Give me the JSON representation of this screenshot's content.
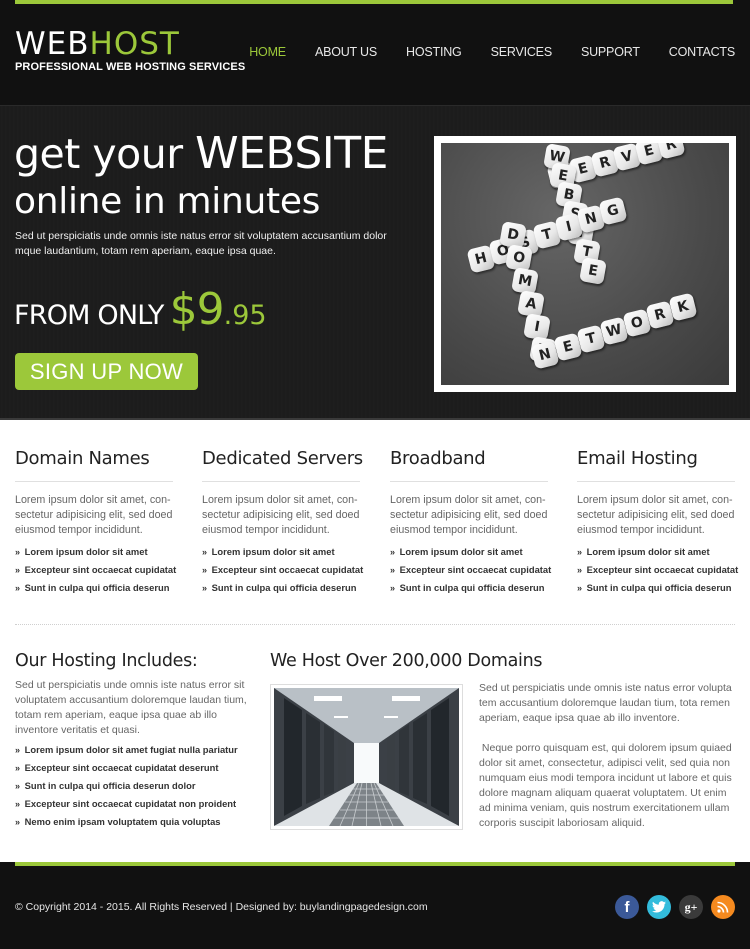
{
  "header": {
    "logo_web": "WEB",
    "logo_host": "HOST",
    "tagline": "PROFESSIONAL WEB HOSTING SERVICES",
    "nav": [
      {
        "label": "HOME",
        "active": true
      },
      {
        "label": "ABOUT US",
        "active": false
      },
      {
        "label": "HOSTING",
        "active": false
      },
      {
        "label": "SERVICES",
        "active": false
      },
      {
        "label": "SUPPORT",
        "active": false
      },
      {
        "label": "CONTACTS",
        "active": false
      }
    ]
  },
  "hero": {
    "title_part1": "get your ",
    "title_part2": "WEBSITE",
    "title_line2": "online in minutes",
    "text": "Sed ut perspiciatis unde omnis iste natus error sit voluptatem accusantium dolor mque laudantium, totam rem aperiam, eaque ipsa quae.",
    "from_only": "FROM ONLY",
    "price_main": "$9",
    "price_cents": ".95",
    "signup_label": "SIGN UP NOW",
    "image_words": [
      "SERVER",
      "WEBSITE",
      "HOSTING",
      "DOMAIN",
      "NETWORK"
    ]
  },
  "features": [
    {
      "title": "Domain Names",
      "text": "Lorem ipsum dolor sit amet, con-sectetur adipisicing elit, sed doed eiusmod tempor incididunt.",
      "items": [
        "Lorem ipsum dolor sit amet",
        "Excepteur sint occaecat cupidatat",
        "Sunt in culpa qui officia deserun"
      ]
    },
    {
      "title": "Dedicated Servers",
      "text": "Lorem ipsum dolor sit amet, con-sectetur adipisicing elit, sed doed eiusmod tempor incididunt.",
      "items": [
        "Lorem ipsum dolor sit amet",
        "Excepteur sint occaecat cupidatat",
        "Sunt in culpa qui officia deserun"
      ]
    },
    {
      "title": "Broadband",
      "text": "Lorem ipsum dolor sit amet, con-sectetur adipisicing elit, sed doed eiusmod tempor incididunt.",
      "items": [
        "Lorem ipsum dolor sit amet",
        "Excepteur sint occaecat cupidatat",
        "Sunt in culpa qui officia deserun"
      ]
    },
    {
      "title": "Email Hosting",
      "text": "Lorem ipsum dolor sit amet, con-sectetur adipisicing elit, sed doed eiusmod tempor incididunt.",
      "items": [
        "Lorem ipsum dolor sit amet",
        "Excepteur sint occaecat cupidatat",
        "Sunt in culpa qui officia deserun"
      ]
    }
  ],
  "bullet": "»",
  "includes": {
    "title": "Our Hosting Includes:",
    "text": "Sed ut perspiciatis unde omnis iste natus error sit voluptatem accusantium doloremque laudan tium, totam rem aperiam, eaque ipsa quae ab illo inventore veritatis et quasi.",
    "items": [
      "Lorem ipsum dolor sit amet fugiat nulla pariatur",
      "Excepteur sint occaecat cupidatat deserunt",
      "Sunt in culpa qui officia deserun dolor",
      "Excepteur sint occaecat cupidatat non proident",
      "Nemo enim ipsam voluptatem quia voluptas"
    ]
  },
  "domains": {
    "title": "We Host Over 200,000 Domains",
    "para1": "Sed ut perspiciatis unde omnis iste natus error volupta tem accusantium doloremque laudan tium, tota remen aperiam, eaque ipsa quae ab illo inventore.",
    "para2": " Neque porro quisquam est, qui dolorem ipsum quiaed dolor sit amet, consectetur, adipisci velit, sed quia non numquam eius modi tempora incidunt ut labore et quis dolore magnam aliquam quaerat voluptatem. Ut enim ad minima veniam, quis nostrum exercitationem ullam corporis suscipit laboriosam aliquid."
  },
  "footer": {
    "copyright": "© Copyright 2014 - 2015. All Rights Reserved | Designed by: buylandingpagedesign.com",
    "social": [
      {
        "name": "facebook",
        "glyph": "f",
        "color": "#3b5998"
      },
      {
        "name": "twitter",
        "glyph": "t",
        "color": "#33bcdc"
      },
      {
        "name": "google-plus",
        "glyph": "g+",
        "color": "#3a3a3a"
      },
      {
        "name": "rss",
        "glyph": "rss",
        "color": "#f58a1f"
      }
    ]
  },
  "colors": {
    "accent": "#9cc83a",
    "header_bg": "#111111",
    "hero_bg": "#1c1c1c"
  }
}
